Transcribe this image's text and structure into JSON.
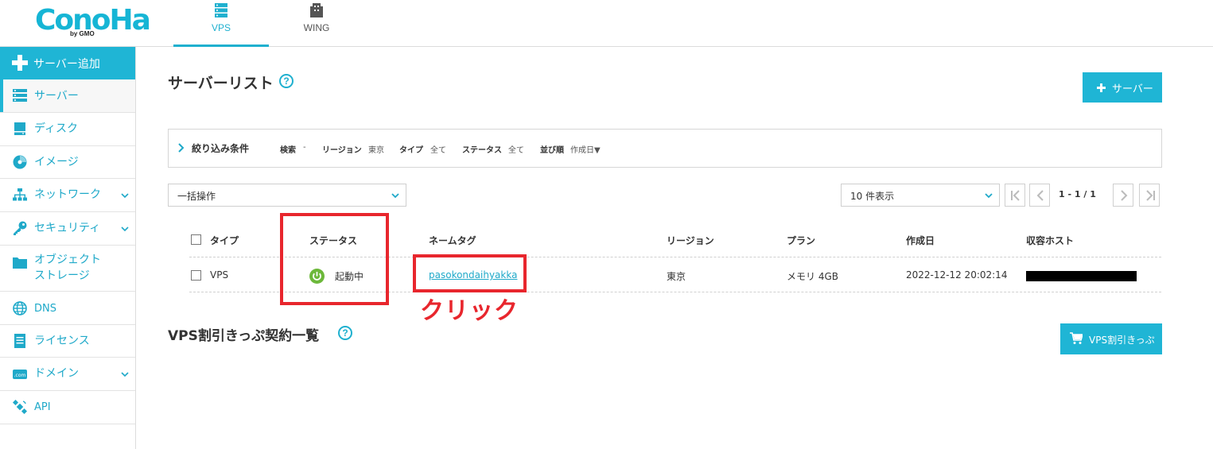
{
  "header": {
    "logo": "ConoHa",
    "logo_sub": "by GMO",
    "tabs": [
      {
        "label": "VPS",
        "icon": "server-stack-icon",
        "active": true
      },
      {
        "label": "WING",
        "icon": "wing-building-icon",
        "active": false
      }
    ]
  },
  "sidebar": {
    "add_label": "サーバー追加",
    "items": [
      {
        "label": "サーバー",
        "icon": "server-icon",
        "active": true
      },
      {
        "label": "ディスク",
        "icon": "disk-icon"
      },
      {
        "label": "イメージ",
        "icon": "image-disc-icon"
      },
      {
        "label": "ネットワーク",
        "icon": "network-icon",
        "expandable": true
      },
      {
        "label": "セキュリティ",
        "icon": "key-icon",
        "expandable": true
      },
      {
        "label_line1": "オブジェクト",
        "label_line2": "ストレージ",
        "icon": "folder-icon"
      },
      {
        "label": "DNS",
        "icon": "globe-icon"
      },
      {
        "label": "ライセンス",
        "icon": "document-icon"
      },
      {
        "label": "ドメイン",
        "icon": "dotcom-icon",
        "expandable": true
      },
      {
        "label": "API",
        "icon": "satellite-icon"
      }
    ]
  },
  "main": {
    "title": "サーバーリスト",
    "help": "?",
    "add_server_label": "サーバー",
    "filter": {
      "title": "絞り込み条件",
      "search_label": "検索",
      "search_value": "-",
      "region_label": "リージョン",
      "region_value": "東京",
      "type_label": "タイプ",
      "type_value": "全て",
      "status_label": "ステータス",
      "status_value": "全て",
      "sort_label": "並び順",
      "sort_value": "作成日▼"
    },
    "bulk_action": "一括操作",
    "per_page": "10 件表示",
    "pagination": "1 - 1 / 1",
    "table": {
      "headers": [
        "タイプ",
        "ステータス",
        "ネームタグ",
        "リージョン",
        "プラン",
        "作成日",
        "収容ホスト"
      ],
      "rows": [
        {
          "type": "VPS",
          "status": "起動中",
          "nametag": "pasokondaihyakka",
          "region": "東京",
          "plan": "メモリ 4GB",
          "created": "2022-12-12 20:02:14",
          "host": ""
        }
      ]
    },
    "annotation": "クリック",
    "section2_title": "VPS割引きっぷ契約一覧",
    "ticket_button": "VPS割引きっぷ"
  },
  "colors": {
    "accent": "#1fb5d5",
    "annotation": "#e8262d",
    "running": "#6cb83a"
  }
}
